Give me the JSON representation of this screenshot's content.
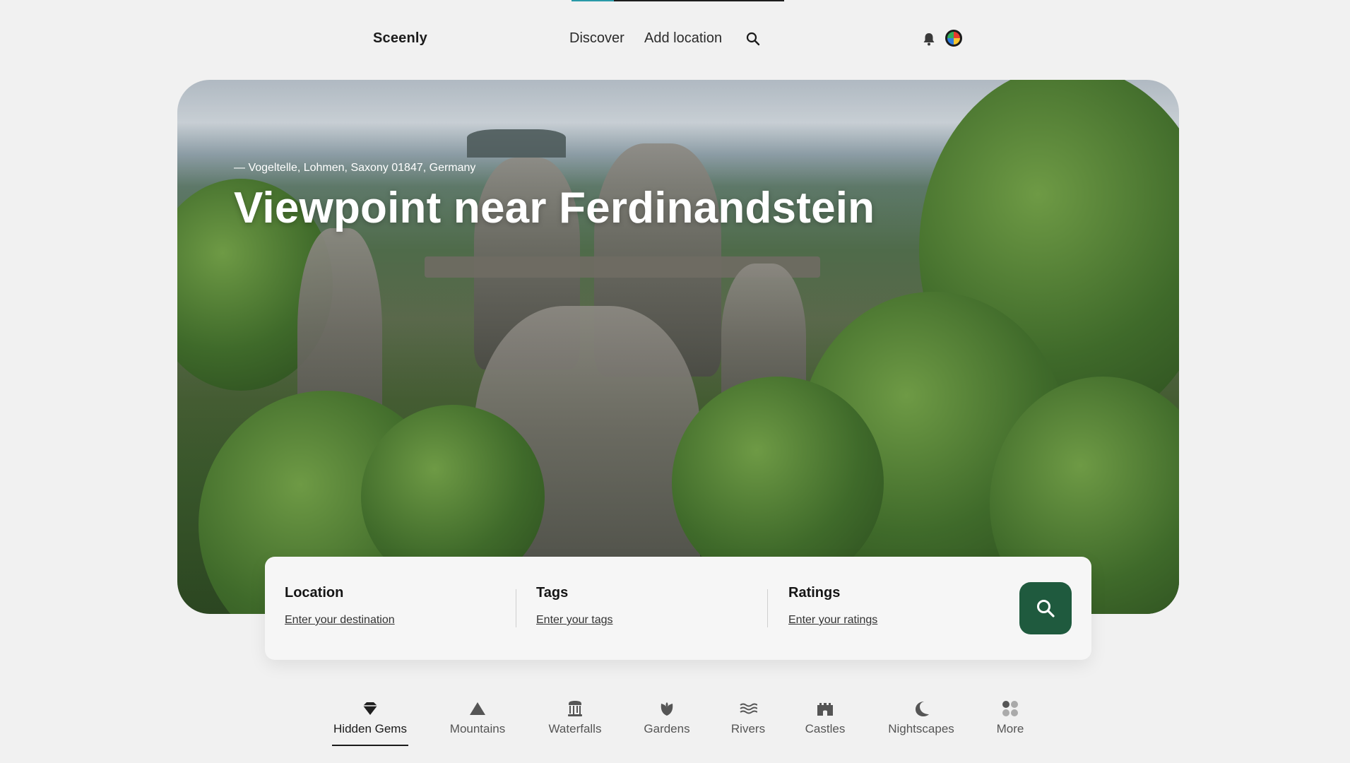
{
  "progress": {
    "fraction": 0.2,
    "fill_color": "#2a9aa8"
  },
  "brand": "Sceenly",
  "nav": {
    "discover": "Discover",
    "add_location": "Add location",
    "search_icon": "search-icon",
    "bell_icon": "bell-icon"
  },
  "hero": {
    "caption": "— Vogeltelle, Lohmen, Saxony 01847, Germany",
    "title": "Viewpoint near Ferdinandstein"
  },
  "search": {
    "location_label": "Location",
    "location_placeholder": "Enter your destination",
    "tags_label": "Tags",
    "tags_placeholder": "Enter your tags",
    "ratings_label": "Ratings",
    "ratings_placeholder": "Enter your ratings",
    "button_color": "#1f5a3e"
  },
  "categories": [
    {
      "label": "Hidden Gems",
      "icon": "gem-icon",
      "active": true
    },
    {
      "label": "Mountains",
      "icon": "mountain-icon"
    },
    {
      "label": "Waterfalls",
      "icon": "waterfall-icon"
    },
    {
      "label": "Gardens",
      "icon": "leaf-icon"
    },
    {
      "label": "Rivers",
      "icon": "waves-icon"
    },
    {
      "label": "Castles",
      "icon": "castle-icon"
    },
    {
      "label": "Nightscapes",
      "icon": "moon-icon"
    },
    {
      "label": "More",
      "icon": "grid-dots-icon"
    }
  ]
}
